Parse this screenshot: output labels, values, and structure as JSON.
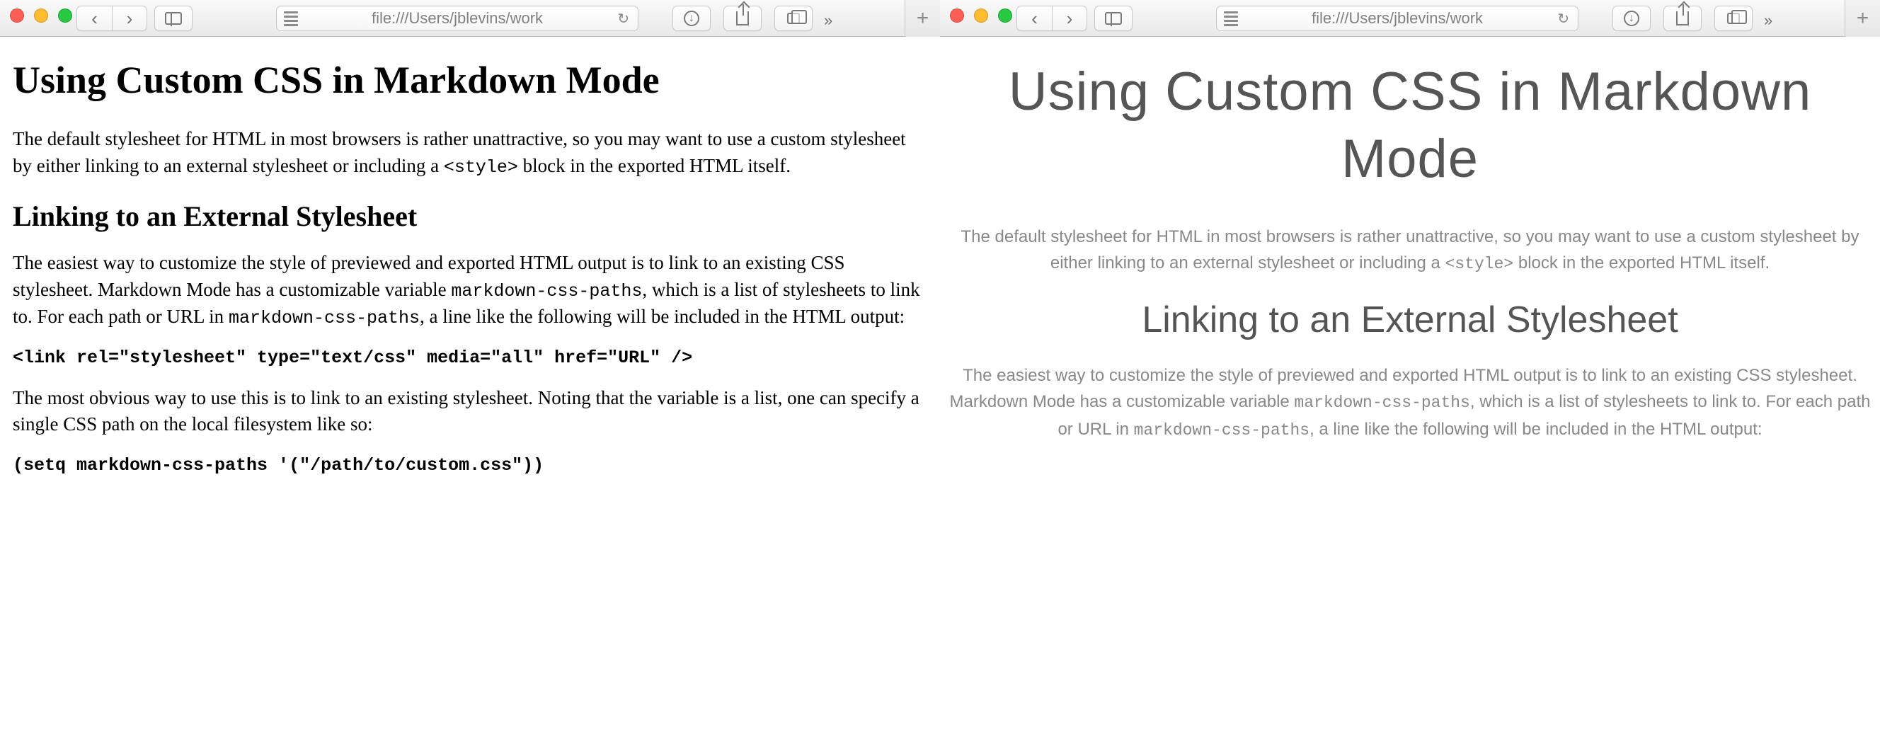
{
  "toolbar": {
    "url": "file:///Users/jblevins/work",
    "new_tab": "+",
    "more": "»",
    "reload": "↻",
    "nav_back": "‹",
    "nav_fwd": "›",
    "download": "↓"
  },
  "left_doc": {
    "h1": "Using Custom CSS in Markdown Mode",
    "p1a": "The default stylesheet for HTML in most browsers is rather unattractive, so you may want to use a custom stylesheet by either linking to an external stylesheet or including a ",
    "p1_code": "<style>",
    "p1b": " block in the exported HTML itself.",
    "h2": "Linking to an External Stylesheet",
    "p2a": "The easiest way to customize the style of previewed and exported HTML output is to link to an existing CSS stylesheet. Markdown Mode has a customizable variable ",
    "p2_code1": "markdown-css-paths",
    "p2b": ", which is a list of stylesheets to link to. For each path or URL in ",
    "p2_code2": "markdown-css-paths",
    "p2c": ", a line like the following will be included in the HTML output:",
    "code_block1": "<link rel=\"stylesheet\" type=\"text/css\" media=\"all\" href=\"URL\" />",
    "p3": "The most obvious way to use this is to link to an existing stylesheet. Noting that the variable is a list, one can specify a single CSS path on the local filesystem like so:",
    "code_block2": "(setq markdown-css-paths '(\"/path/to/custom.css\"))"
  },
  "right_doc": {
    "h1": "Using Custom CSS in Markdown Mode",
    "p1a": "The default stylesheet for HTML in most browsers is rather unattractive, so you may want to use a custom stylesheet by either linking to an external stylesheet or including a ",
    "p1_code": "<style>",
    "p1b": " block in the exported HTML itself.",
    "h2": "Linking to an External Stylesheet",
    "p2a": "The easiest way to customize the style of previewed and exported HTML output is to link to an existing CSS stylesheet. Markdown Mode has a customizable variable ",
    "p2_code1": "markdown-css-paths",
    "p2b": ", which is a list of stylesheets to link to. For each path or URL in ",
    "p2_code2": "markdown-css-paths",
    "p2c": ", a line like the following will be included in the HTML output:"
  }
}
